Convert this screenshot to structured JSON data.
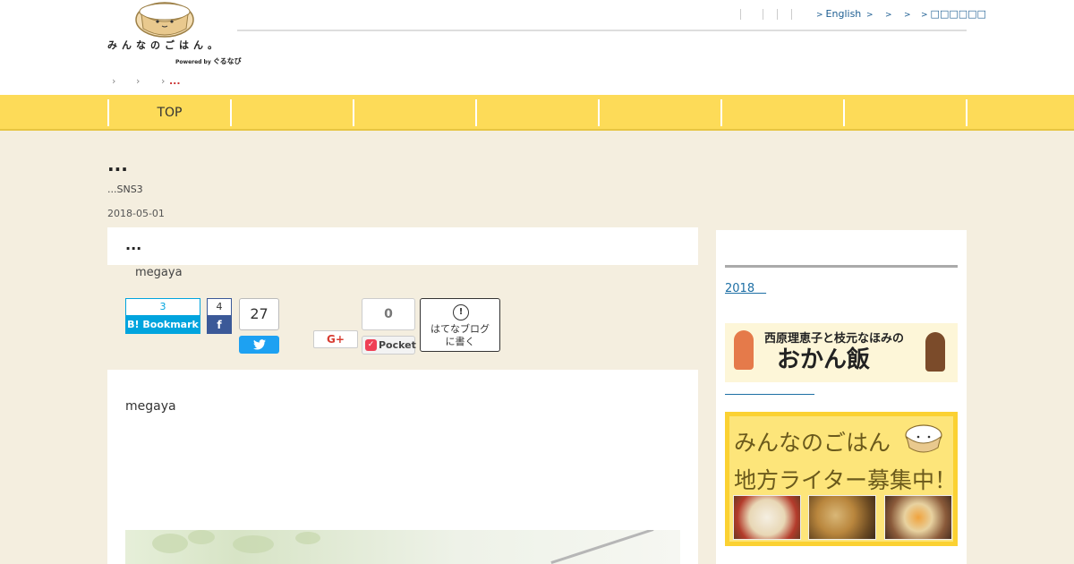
{
  "header": {
    "logo_text": "みんなのごはん。",
    "logo_powered": "Powered by",
    "logo_brand": "ぐるなび",
    "util_links": [
      {
        "label": "English"
      },
      {
        "label": ""
      },
      {
        "label": ""
      },
      {
        "label": "□□□□□□"
      }
    ]
  },
  "breadcrumb": {
    "current": "..."
  },
  "nav": {
    "items": [
      {
        "label": "TOP"
      },
      {
        "label": ""
      },
      {
        "label": ""
      },
      {
        "label": ""
      },
      {
        "label": ""
      },
      {
        "label": ""
      },
      {
        "label": ""
      }
    ]
  },
  "entry": {
    "title": "...",
    "subtitle": "...SNS3",
    "date": "2018-05-01",
    "section_title": "...",
    "author": "megaya"
  },
  "share": {
    "hatena_count": "3",
    "hatena_label": "Bookmark",
    "facebook_count": "4",
    "twitter_count": "27",
    "googleplus_label": "G+",
    "pocket_count": "0",
    "pocket_label": "Pocket",
    "hatenablog_label_1": "はてなブログ",
    "hatenablog_label_2": "に書く"
  },
  "content": {
    "author": "megaya"
  },
  "sidebar": {
    "archive_link": "2018　",
    "okan_title_small": "西原理恵子と枝元なほみの",
    "okan_title_large": "おかん飯",
    "writer_line1": "みんなのごはん",
    "writer_line2": "地方ライター募集中！"
  },
  "colors": {
    "nav_yellow": "#fddb58",
    "page_bg": "#f4eedf",
    "link_blue": "#1d6fa5",
    "hatena_blue": "#00a4de",
    "facebook_blue": "#3b5998",
    "twitter_blue": "#1da1f2",
    "pocket_red": "#ef4056"
  }
}
